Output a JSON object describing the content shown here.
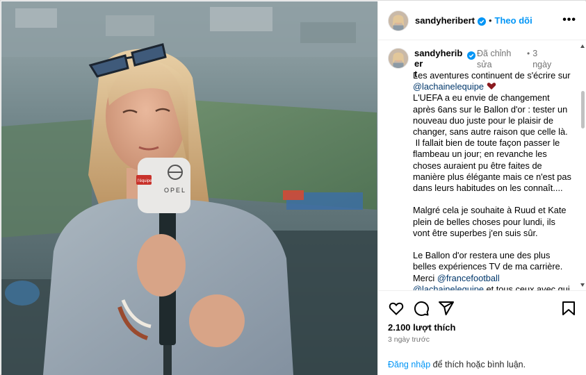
{
  "post": {
    "username": "sandyheribert",
    "follow_label": "Theo dõi",
    "separator": "•",
    "more_label": "•••"
  },
  "caption": {
    "username_line1": "sandyheriber",
    "username_line2": "t",
    "edited_label": "Đã chỉnh sửa",
    "time_sep": "•",
    "time_label": "3 ngày",
    "line_intro": "Les aventures continuent de s'écrire sur ",
    "mention1": "@lachainelequipe",
    "paragraph1": "L'UEFA a eu envie de changement après 6ans sur le Ballon d'or : tester un nouveau duo juste pour le plaisir de changer, sans autre raison que celle là.\n Il fallait bien de toute façon passer le flambeau un jour; en revanche les choses auraient pu être faites de manière plus élégante mais ce n'est pas dans leurs habitudes on les connaît....",
    "paragraph2": "Malgré cela je souhaite à Ruud et Kate plein de belles choses pour lundi, ils vont être superbes j'en suis sûr.",
    "paragraph3a": "Le Ballon d'or restera une des plus belles expériences TV de ma carrière.\nMerci ",
    "mention2": "@francefootball",
    "mention3": "@lachainelequipe",
    "paragraph3b": " et tous ceux avec qui"
  },
  "footer": {
    "likes": "2.100 lượt thích",
    "date": "3 ngày trước",
    "login_link": "Đăng nhập",
    "login_rest": " để thích hoặc bình luận."
  },
  "photo": {
    "mic_brand": "OPEL",
    "mic_flag": "l'équipe"
  },
  "colors": {
    "follow_blue": "#0095f6",
    "mention_blue": "#00376b",
    "muted_gray": "#737373",
    "verified_blue": "#0095f6"
  },
  "icons": {
    "like": "heart-icon",
    "comment": "comment-icon",
    "share": "share-icon",
    "save": "bookmark-icon",
    "verified": "verified-badge-icon",
    "more": "more-icon"
  }
}
